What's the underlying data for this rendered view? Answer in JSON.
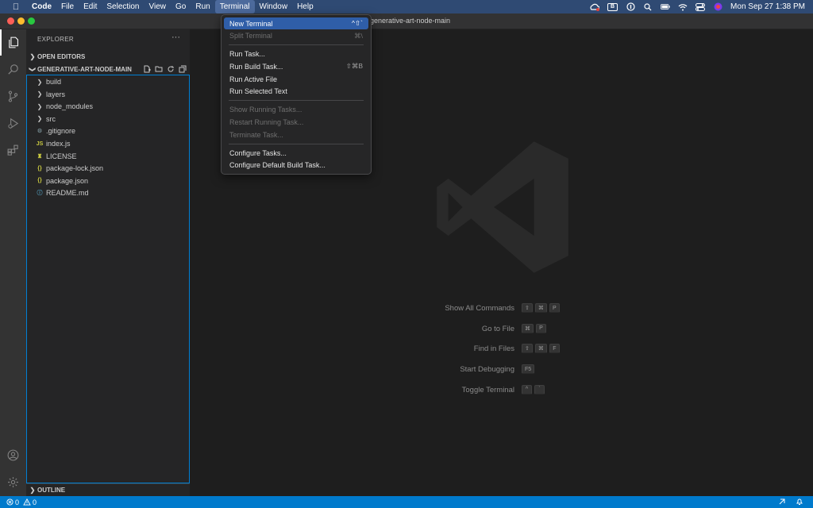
{
  "menubar": {
    "app_name": "Code",
    "items": [
      "File",
      "Edit",
      "Selection",
      "View",
      "Go",
      "Run",
      "Terminal",
      "Window",
      "Help"
    ],
    "active_item": "Terminal",
    "tray": {
      "bluetooth_label": "B",
      "datetime": "Mon Sep 27  1:38 PM"
    }
  },
  "window": {
    "title": "generative-art-node-main"
  },
  "sidebar": {
    "header": "EXPLORER",
    "more": "···",
    "open_editors": "OPEN EDITORS",
    "project": "GENERATIVE-ART-NODE-MAIN",
    "folders": [
      "build",
      "layers",
      "node_modules",
      "src"
    ],
    "files": [
      {
        "name": ".gitignore",
        "icon": "gear-icon",
        "glyph": "⚙",
        "color": "#6d8086"
      },
      {
        "name": "index.js",
        "icon": "js-icon",
        "glyph": "JS",
        "color": "#cbcb41"
      },
      {
        "name": "LICENSE",
        "icon": "license-icon",
        "glyph": "♜",
        "color": "#cbcb41"
      },
      {
        "name": "package-lock.json",
        "icon": "json-icon",
        "glyph": "{}",
        "color": "#cbcb41"
      },
      {
        "name": "package.json",
        "icon": "json-icon",
        "glyph": "{}",
        "color": "#cbcb41"
      },
      {
        "name": "README.md",
        "icon": "info-icon",
        "glyph": "ⓘ",
        "color": "#519aba"
      }
    ],
    "outline": "OUTLINE"
  },
  "editor": {
    "shortcuts": [
      {
        "label": "Show All Commands",
        "keys": [
          "⇧",
          "⌘",
          "P"
        ]
      },
      {
        "label": "Go to File",
        "keys": [
          "⌘",
          "P"
        ]
      },
      {
        "label": "Find in Files",
        "keys": [
          "⇧",
          "⌘",
          "F"
        ]
      },
      {
        "label": "Start Debugging",
        "keys": [
          "F5"
        ]
      },
      {
        "label": "Toggle Terminal",
        "keys": [
          "^",
          "`"
        ]
      }
    ]
  },
  "statusbar": {
    "errors": "0",
    "warnings": "0"
  },
  "terminal_menu": {
    "items": [
      {
        "label": "New Terminal",
        "shortcut": "^⇧`",
        "state": "highlight"
      },
      {
        "label": "Split Terminal",
        "shortcut": "⌘\\",
        "state": "disabled"
      },
      {
        "sep": true
      },
      {
        "label": "Run Task...",
        "shortcut": "",
        "state": "normal"
      },
      {
        "label": "Run Build Task...",
        "shortcut": "⇧⌘B",
        "state": "normal"
      },
      {
        "label": "Run Active File",
        "shortcut": "",
        "state": "normal"
      },
      {
        "label": "Run Selected Text",
        "shortcut": "",
        "state": "normal"
      },
      {
        "sep": true
      },
      {
        "label": "Show Running Tasks...",
        "shortcut": "",
        "state": "disabled"
      },
      {
        "label": "Restart Running Task...",
        "shortcut": "",
        "state": "disabled"
      },
      {
        "label": "Terminate Task...",
        "shortcut": "",
        "state": "disabled"
      },
      {
        "sep": true
      },
      {
        "label": "Configure Tasks...",
        "shortcut": "",
        "state": "normal"
      },
      {
        "label": "Configure Default Build Task...",
        "shortcut": "",
        "state": "normal"
      }
    ]
  },
  "colors": {
    "accent": "#007acc",
    "menu_highlight": "#2f5ea8",
    "focus_border": "#007fd4"
  }
}
